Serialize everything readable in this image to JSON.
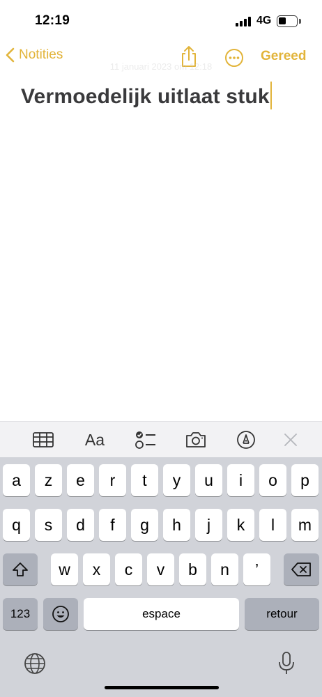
{
  "status_bar": {
    "time": "12:19",
    "network": "4G",
    "battery_level": 0.45
  },
  "nav": {
    "back_label": "Notities",
    "done_label": "Gereed",
    "date_text": "11 januari 2023 om 12:18",
    "accent_color": "#e2b43a"
  },
  "note": {
    "title": "Vermoedelijk uitlaat stuk"
  },
  "toolbar": {
    "items": [
      "table-icon",
      "Aa",
      "checklist-icon",
      "camera-icon",
      "markup-icon",
      "close-icon"
    ],
    "format_label": "Aa"
  },
  "keyboard": {
    "row1": [
      "a",
      "z",
      "e",
      "r",
      "t",
      "y",
      "u",
      "i",
      "o",
      "p"
    ],
    "row2": [
      "q",
      "s",
      "d",
      "f",
      "g",
      "h",
      "j",
      "k",
      "l",
      "m"
    ],
    "row3": [
      "w",
      "x",
      "c",
      "v",
      "b",
      "n",
      "’"
    ],
    "numbers_label": "123",
    "space_label": "espace",
    "return_label": "retour"
  }
}
